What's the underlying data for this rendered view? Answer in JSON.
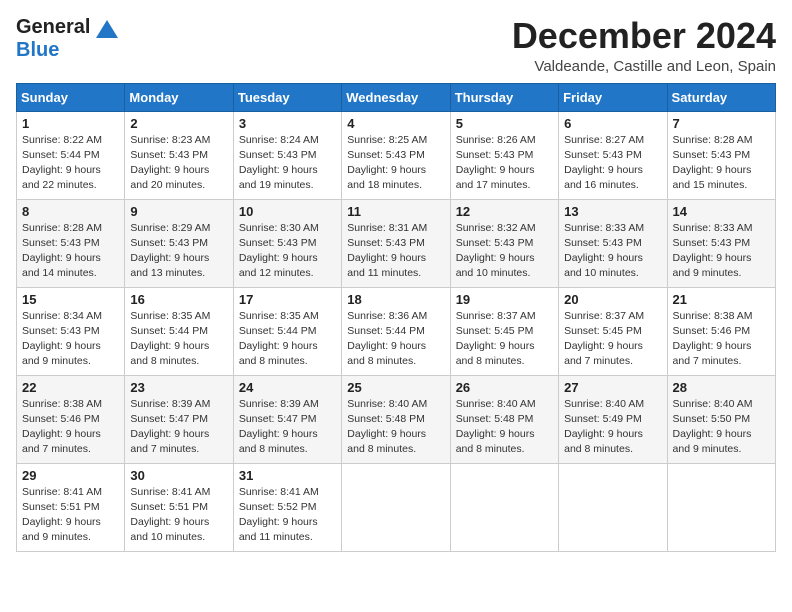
{
  "header": {
    "logo_general": "General",
    "logo_blue": "Blue",
    "month_title": "December 2024",
    "location": "Valdeande, Castille and Leon, Spain"
  },
  "weekdays": [
    "Sunday",
    "Monday",
    "Tuesday",
    "Wednesday",
    "Thursday",
    "Friday",
    "Saturday"
  ],
  "weeks": [
    [
      {
        "day": "1",
        "sunrise": "8:22 AM",
        "sunset": "5:44 PM",
        "daylight": "9 hours and 22 minutes."
      },
      {
        "day": "2",
        "sunrise": "8:23 AM",
        "sunset": "5:43 PM",
        "daylight": "9 hours and 20 minutes."
      },
      {
        "day": "3",
        "sunrise": "8:24 AM",
        "sunset": "5:43 PM",
        "daylight": "9 hours and 19 minutes."
      },
      {
        "day": "4",
        "sunrise": "8:25 AM",
        "sunset": "5:43 PM",
        "daylight": "9 hours and 18 minutes."
      },
      {
        "day": "5",
        "sunrise": "8:26 AM",
        "sunset": "5:43 PM",
        "daylight": "9 hours and 17 minutes."
      },
      {
        "day": "6",
        "sunrise": "8:27 AM",
        "sunset": "5:43 PM",
        "daylight": "9 hours and 16 minutes."
      },
      {
        "day": "7",
        "sunrise": "8:28 AM",
        "sunset": "5:43 PM",
        "daylight": "9 hours and 15 minutes."
      }
    ],
    [
      {
        "day": "8",
        "sunrise": "8:28 AM",
        "sunset": "5:43 PM",
        "daylight": "9 hours and 14 minutes."
      },
      {
        "day": "9",
        "sunrise": "8:29 AM",
        "sunset": "5:43 PM",
        "daylight": "9 hours and 13 minutes."
      },
      {
        "day": "10",
        "sunrise": "8:30 AM",
        "sunset": "5:43 PM",
        "daylight": "9 hours and 12 minutes."
      },
      {
        "day": "11",
        "sunrise": "8:31 AM",
        "sunset": "5:43 PM",
        "daylight": "9 hours and 11 minutes."
      },
      {
        "day": "12",
        "sunrise": "8:32 AM",
        "sunset": "5:43 PM",
        "daylight": "9 hours and 10 minutes."
      },
      {
        "day": "13",
        "sunrise": "8:33 AM",
        "sunset": "5:43 PM",
        "daylight": "9 hours and 10 minutes."
      },
      {
        "day": "14",
        "sunrise": "8:33 AM",
        "sunset": "5:43 PM",
        "daylight": "9 hours and 9 minutes."
      }
    ],
    [
      {
        "day": "15",
        "sunrise": "8:34 AM",
        "sunset": "5:43 PM",
        "daylight": "9 hours and 9 minutes."
      },
      {
        "day": "16",
        "sunrise": "8:35 AM",
        "sunset": "5:44 PM",
        "daylight": "9 hours and 8 minutes."
      },
      {
        "day": "17",
        "sunrise": "8:35 AM",
        "sunset": "5:44 PM",
        "daylight": "9 hours and 8 minutes."
      },
      {
        "day": "18",
        "sunrise": "8:36 AM",
        "sunset": "5:44 PM",
        "daylight": "9 hours and 8 minutes."
      },
      {
        "day": "19",
        "sunrise": "8:37 AM",
        "sunset": "5:45 PM",
        "daylight": "9 hours and 8 minutes."
      },
      {
        "day": "20",
        "sunrise": "8:37 AM",
        "sunset": "5:45 PM",
        "daylight": "9 hours and 7 minutes."
      },
      {
        "day": "21",
        "sunrise": "8:38 AM",
        "sunset": "5:46 PM",
        "daylight": "9 hours and 7 minutes."
      }
    ],
    [
      {
        "day": "22",
        "sunrise": "8:38 AM",
        "sunset": "5:46 PM",
        "daylight": "9 hours and 7 minutes."
      },
      {
        "day": "23",
        "sunrise": "8:39 AM",
        "sunset": "5:47 PM",
        "daylight": "9 hours and 7 minutes."
      },
      {
        "day": "24",
        "sunrise": "8:39 AM",
        "sunset": "5:47 PM",
        "daylight": "9 hours and 8 minutes."
      },
      {
        "day": "25",
        "sunrise": "8:40 AM",
        "sunset": "5:48 PM",
        "daylight": "9 hours and 8 minutes."
      },
      {
        "day": "26",
        "sunrise": "8:40 AM",
        "sunset": "5:48 PM",
        "daylight": "9 hours and 8 minutes."
      },
      {
        "day": "27",
        "sunrise": "8:40 AM",
        "sunset": "5:49 PM",
        "daylight": "9 hours and 8 minutes."
      },
      {
        "day": "28",
        "sunrise": "8:40 AM",
        "sunset": "5:50 PM",
        "daylight": "9 hours and 9 minutes."
      }
    ],
    [
      {
        "day": "29",
        "sunrise": "8:41 AM",
        "sunset": "5:51 PM",
        "daylight": "9 hours and 9 minutes."
      },
      {
        "day": "30",
        "sunrise": "8:41 AM",
        "sunset": "5:51 PM",
        "daylight": "9 hours and 10 minutes."
      },
      {
        "day": "31",
        "sunrise": "8:41 AM",
        "sunset": "5:52 PM",
        "daylight": "9 hours and 11 minutes."
      },
      null,
      null,
      null,
      null
    ]
  ],
  "labels": {
    "sunrise": "Sunrise:",
    "sunset": "Sunset:",
    "daylight": "Daylight:"
  }
}
